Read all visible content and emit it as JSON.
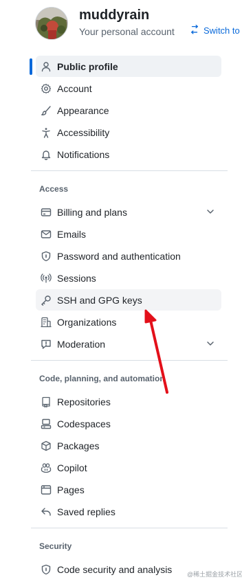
{
  "account": {
    "username": "muddyrain",
    "subtitle": "Your personal account",
    "switch_label": "Switch to"
  },
  "nav": {
    "top": [
      {
        "label": "Public profile",
        "icon": "person-icon",
        "selected": true
      },
      {
        "label": "Account",
        "icon": "gear-icon"
      },
      {
        "label": "Appearance",
        "icon": "paintbrush-icon"
      },
      {
        "label": "Accessibility",
        "icon": "accessibility-icon"
      },
      {
        "label": "Notifications",
        "icon": "bell-icon"
      }
    ],
    "access_title": "Access",
    "access": [
      {
        "label": "Billing and plans",
        "icon": "credit-card-icon",
        "expandable": true
      },
      {
        "label": "Emails",
        "icon": "mail-icon"
      },
      {
        "label": "Password and authentication",
        "icon": "shield-lock-icon"
      },
      {
        "label": "Sessions",
        "icon": "broadcast-icon"
      },
      {
        "label": "SSH and GPG keys",
        "icon": "key-icon",
        "highlighted": true
      },
      {
        "label": "Organizations",
        "icon": "organization-icon"
      },
      {
        "label": "Moderation",
        "icon": "report-icon",
        "expandable": true
      }
    ],
    "code_title": "Code, planning, and automation",
    "code": [
      {
        "label": "Repositories",
        "icon": "repo-icon"
      },
      {
        "label": "Codespaces",
        "icon": "codespaces-icon"
      },
      {
        "label": "Packages",
        "icon": "package-icon"
      },
      {
        "label": "Copilot",
        "icon": "copilot-icon"
      },
      {
        "label": "Pages",
        "icon": "browser-icon"
      },
      {
        "label": "Saved replies",
        "icon": "reply-icon"
      }
    ],
    "security_title": "Security",
    "security": [
      {
        "label": "Code security and analysis",
        "icon": "shield-lock-icon"
      }
    ]
  },
  "watermark": "@稀土掘金技术社区",
  "colors": {
    "accent": "#0969da",
    "annotation_arrow": "#e3101a",
    "selected_bg": "#eff2f5"
  }
}
